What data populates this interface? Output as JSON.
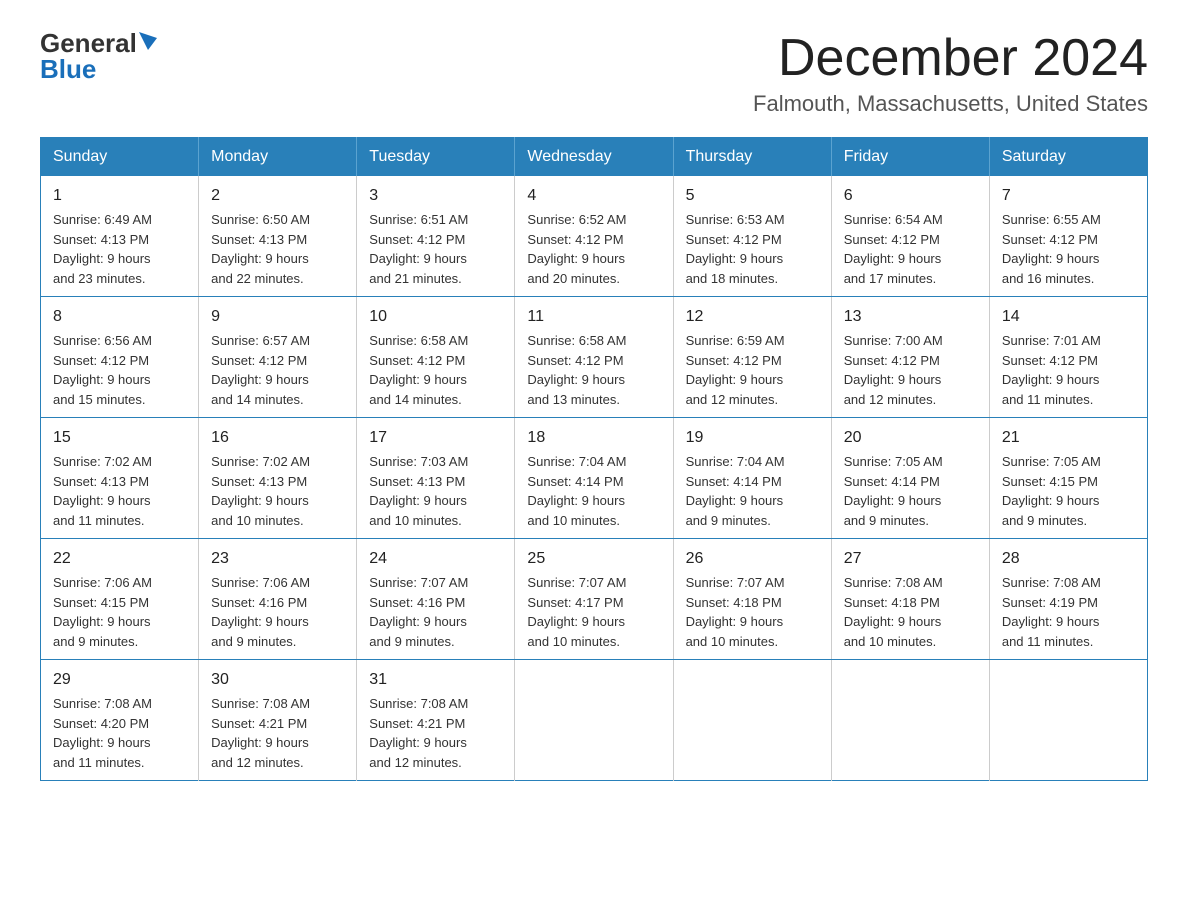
{
  "logo": {
    "general": "General",
    "blue": "Blue"
  },
  "title": "December 2024",
  "location": "Falmouth, Massachusetts, United States",
  "days_of_week": [
    "Sunday",
    "Monday",
    "Tuesday",
    "Wednesday",
    "Thursday",
    "Friday",
    "Saturday"
  ],
  "weeks": [
    [
      {
        "day": "1",
        "sunrise": "6:49 AM",
        "sunset": "4:13 PM",
        "daylight": "9 hours and 23 minutes."
      },
      {
        "day": "2",
        "sunrise": "6:50 AM",
        "sunset": "4:13 PM",
        "daylight": "9 hours and 22 minutes."
      },
      {
        "day": "3",
        "sunrise": "6:51 AM",
        "sunset": "4:12 PM",
        "daylight": "9 hours and 21 minutes."
      },
      {
        "day": "4",
        "sunrise": "6:52 AM",
        "sunset": "4:12 PM",
        "daylight": "9 hours and 20 minutes."
      },
      {
        "day": "5",
        "sunrise": "6:53 AM",
        "sunset": "4:12 PM",
        "daylight": "9 hours and 18 minutes."
      },
      {
        "day": "6",
        "sunrise": "6:54 AM",
        "sunset": "4:12 PM",
        "daylight": "9 hours and 17 minutes."
      },
      {
        "day": "7",
        "sunrise": "6:55 AM",
        "sunset": "4:12 PM",
        "daylight": "9 hours and 16 minutes."
      }
    ],
    [
      {
        "day": "8",
        "sunrise": "6:56 AM",
        "sunset": "4:12 PM",
        "daylight": "9 hours and 15 minutes."
      },
      {
        "day": "9",
        "sunrise": "6:57 AM",
        "sunset": "4:12 PM",
        "daylight": "9 hours and 14 minutes."
      },
      {
        "day": "10",
        "sunrise": "6:58 AM",
        "sunset": "4:12 PM",
        "daylight": "9 hours and 14 minutes."
      },
      {
        "day": "11",
        "sunrise": "6:58 AM",
        "sunset": "4:12 PM",
        "daylight": "9 hours and 13 minutes."
      },
      {
        "day": "12",
        "sunrise": "6:59 AM",
        "sunset": "4:12 PM",
        "daylight": "9 hours and 12 minutes."
      },
      {
        "day": "13",
        "sunrise": "7:00 AM",
        "sunset": "4:12 PM",
        "daylight": "9 hours and 12 minutes."
      },
      {
        "day": "14",
        "sunrise": "7:01 AM",
        "sunset": "4:12 PM",
        "daylight": "9 hours and 11 minutes."
      }
    ],
    [
      {
        "day": "15",
        "sunrise": "7:02 AM",
        "sunset": "4:13 PM",
        "daylight": "9 hours and 11 minutes."
      },
      {
        "day": "16",
        "sunrise": "7:02 AM",
        "sunset": "4:13 PM",
        "daylight": "9 hours and 10 minutes."
      },
      {
        "day": "17",
        "sunrise": "7:03 AM",
        "sunset": "4:13 PM",
        "daylight": "9 hours and 10 minutes."
      },
      {
        "day": "18",
        "sunrise": "7:04 AM",
        "sunset": "4:14 PM",
        "daylight": "9 hours and 10 minutes."
      },
      {
        "day": "19",
        "sunrise": "7:04 AM",
        "sunset": "4:14 PM",
        "daylight": "9 hours and 9 minutes."
      },
      {
        "day": "20",
        "sunrise": "7:05 AM",
        "sunset": "4:14 PM",
        "daylight": "9 hours and 9 minutes."
      },
      {
        "day": "21",
        "sunrise": "7:05 AM",
        "sunset": "4:15 PM",
        "daylight": "9 hours and 9 minutes."
      }
    ],
    [
      {
        "day": "22",
        "sunrise": "7:06 AM",
        "sunset": "4:15 PM",
        "daylight": "9 hours and 9 minutes."
      },
      {
        "day": "23",
        "sunrise": "7:06 AM",
        "sunset": "4:16 PM",
        "daylight": "9 hours and 9 minutes."
      },
      {
        "day": "24",
        "sunrise": "7:07 AM",
        "sunset": "4:16 PM",
        "daylight": "9 hours and 9 minutes."
      },
      {
        "day": "25",
        "sunrise": "7:07 AM",
        "sunset": "4:17 PM",
        "daylight": "9 hours and 10 minutes."
      },
      {
        "day": "26",
        "sunrise": "7:07 AM",
        "sunset": "4:18 PM",
        "daylight": "9 hours and 10 minutes."
      },
      {
        "day": "27",
        "sunrise": "7:08 AM",
        "sunset": "4:18 PM",
        "daylight": "9 hours and 10 minutes."
      },
      {
        "day": "28",
        "sunrise": "7:08 AM",
        "sunset": "4:19 PM",
        "daylight": "9 hours and 11 minutes."
      }
    ],
    [
      {
        "day": "29",
        "sunrise": "7:08 AM",
        "sunset": "4:20 PM",
        "daylight": "9 hours and 11 minutes."
      },
      {
        "day": "30",
        "sunrise": "7:08 AM",
        "sunset": "4:21 PM",
        "daylight": "9 hours and 12 minutes."
      },
      {
        "day": "31",
        "sunrise": "7:08 AM",
        "sunset": "4:21 PM",
        "daylight": "9 hours and 12 minutes."
      },
      null,
      null,
      null,
      null
    ]
  ],
  "labels": {
    "sunrise": "Sunrise:",
    "sunset": "Sunset:",
    "daylight": "Daylight:"
  }
}
